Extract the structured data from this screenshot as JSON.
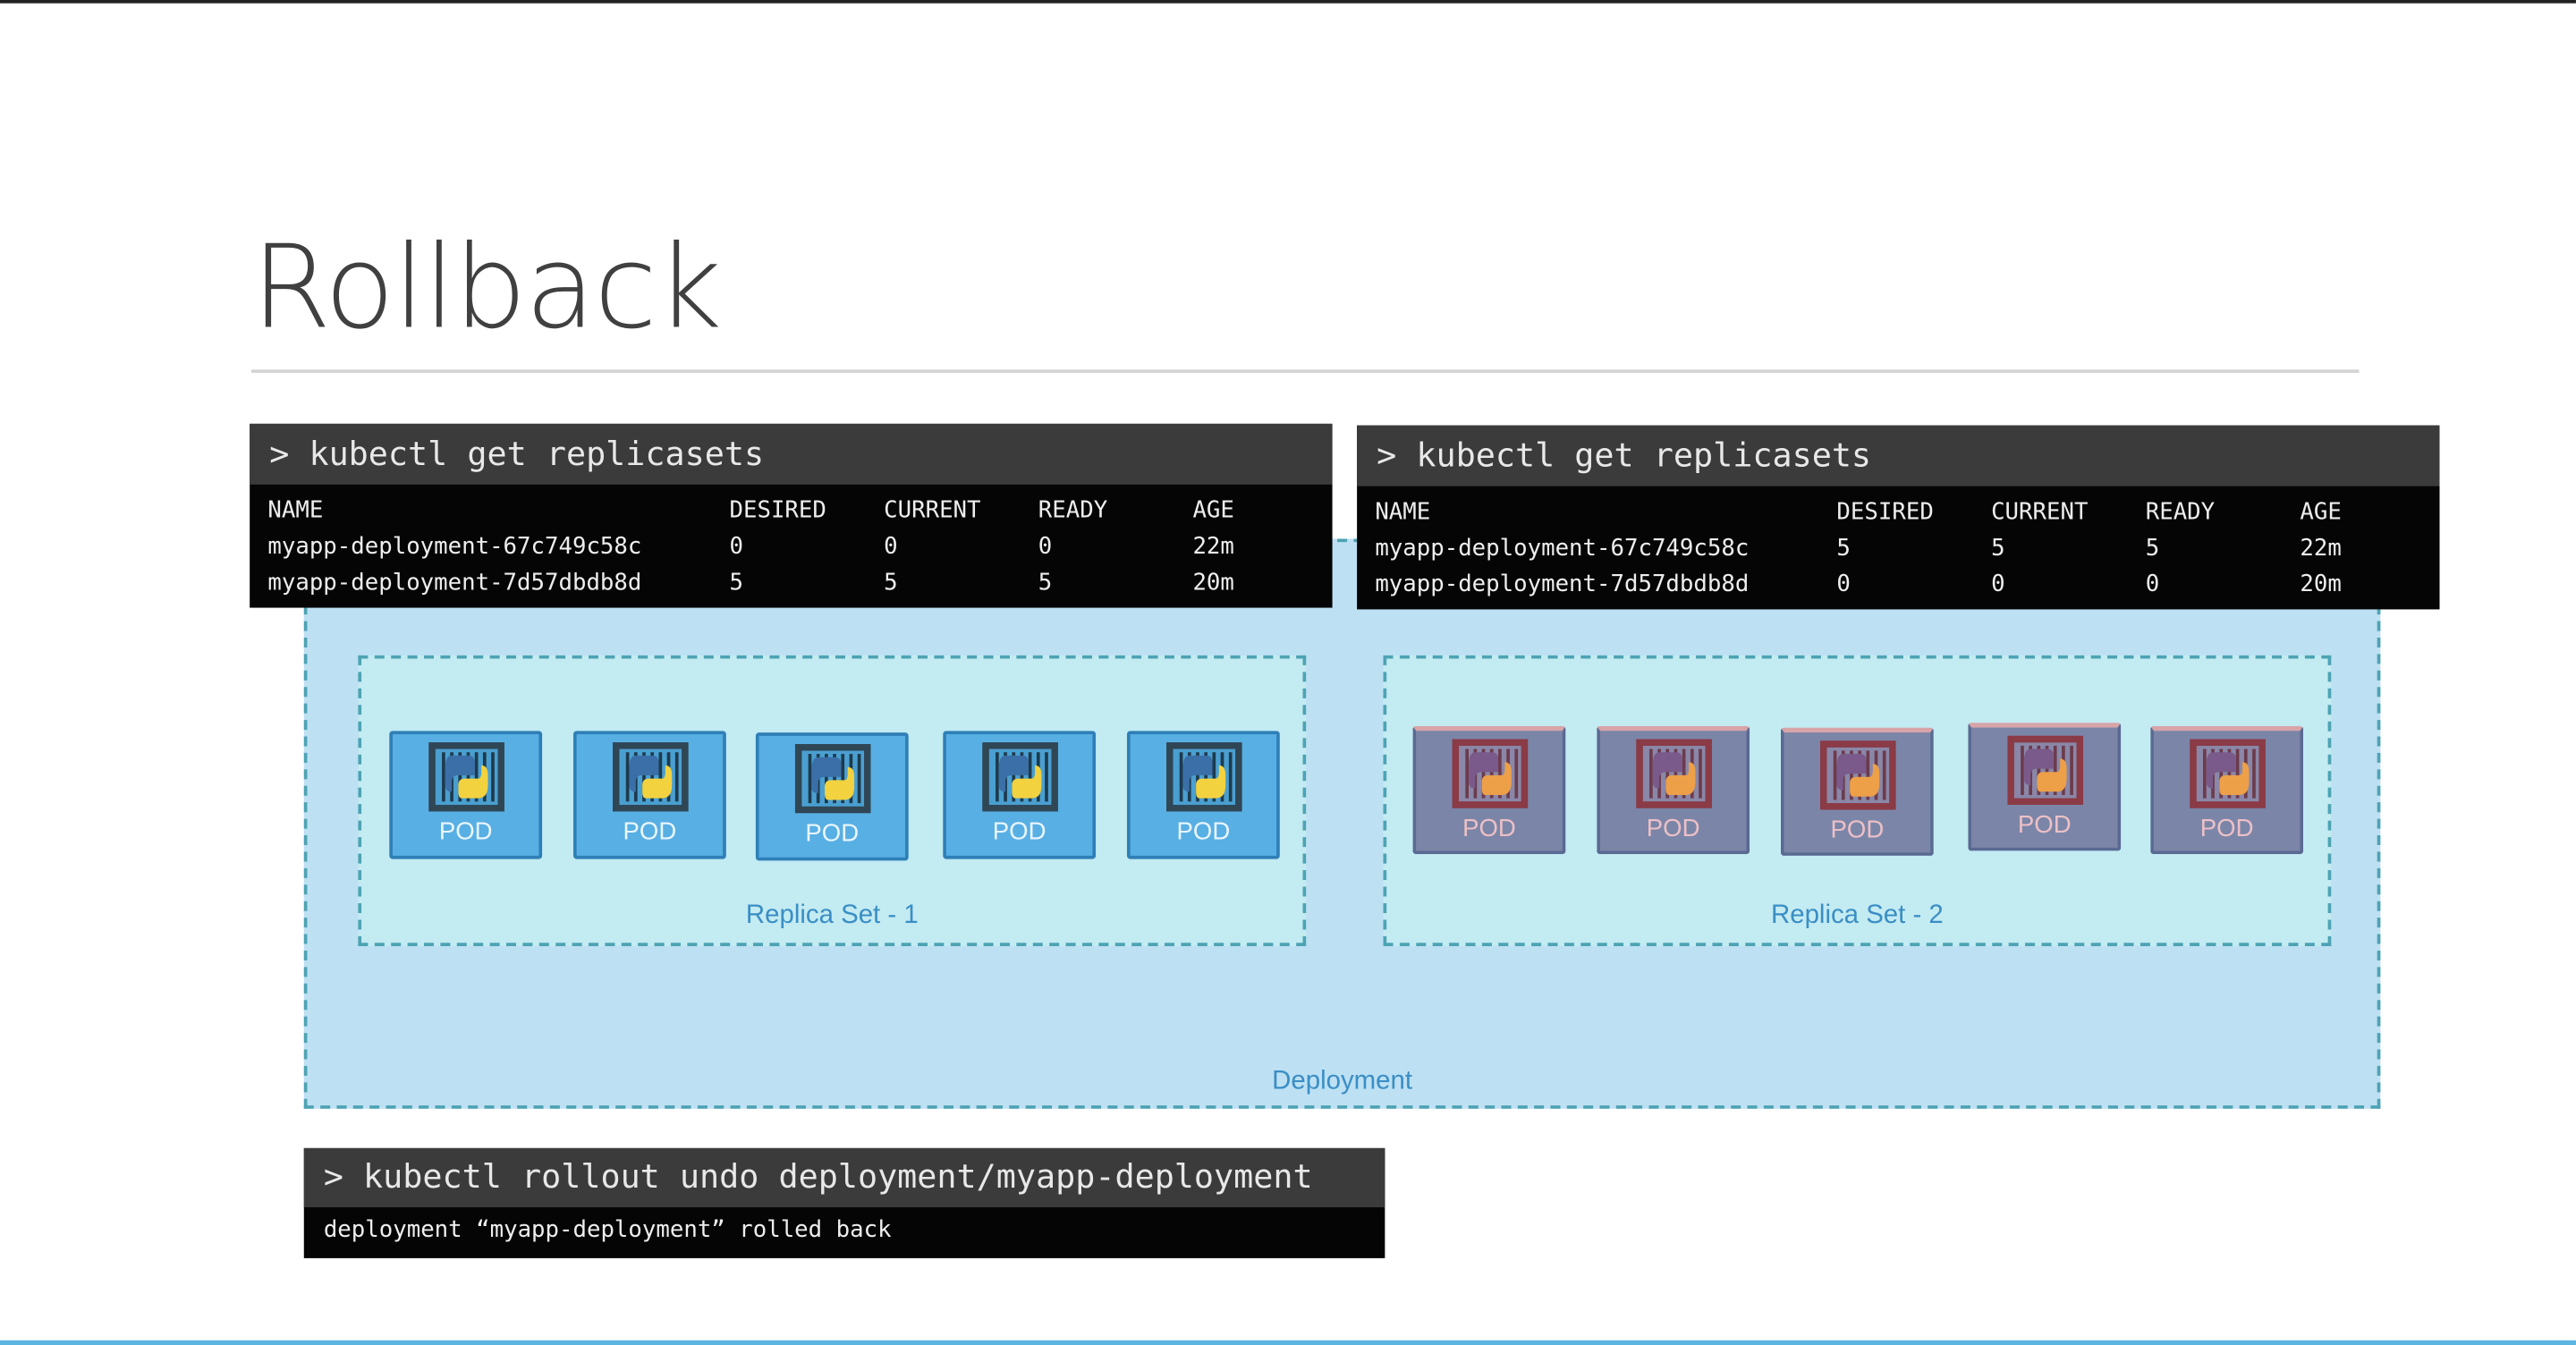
{
  "slide": {
    "title": "Rollback"
  },
  "deployment": {
    "label": "Deployment"
  },
  "replica_sets": [
    {
      "label": "Replica Set - 1",
      "state": "active",
      "pods": [
        "POD",
        "POD",
        "POD",
        "POD",
        "POD"
      ]
    },
    {
      "label": "Replica Set - 2",
      "state": "inactive",
      "pods": [
        "POD",
        "POD",
        "POD",
        "POD",
        "POD"
      ]
    }
  ],
  "terminals": [
    {
      "command": "> kubectl get replicasets",
      "columns": [
        "NAME",
        "DESIRED",
        "CURRENT",
        "READY",
        "AGE"
      ],
      "rows": [
        [
          "myapp-deployment-67c749c58c",
          "0",
          "0",
          "0",
          "22m"
        ],
        [
          "myapp-deployment-7d57dbdb8d",
          "5",
          "5",
          "5",
          "20m"
        ]
      ]
    },
    {
      "command": "> kubectl get replicasets",
      "columns": [
        "NAME",
        "DESIRED",
        "CURRENT",
        "READY",
        "AGE"
      ],
      "rows": [
        [
          "myapp-deployment-67c749c58c",
          "5",
          "5",
          "5",
          "22m"
        ],
        [
          "myapp-deployment-7d57dbdb8d",
          "0",
          "0",
          "0",
          "20m"
        ]
      ]
    },
    {
      "command": "> kubectl rollout undo deployment/myapp-deployment",
      "output": "deployment “myapp-deployment” rolled back"
    }
  ],
  "colors": {
    "pod_active": "#58afe3",
    "pod_inactive": "#7b85a8",
    "deployment_bg": "#bde0f3",
    "replicaset_bg": "#c3ebf2"
  }
}
